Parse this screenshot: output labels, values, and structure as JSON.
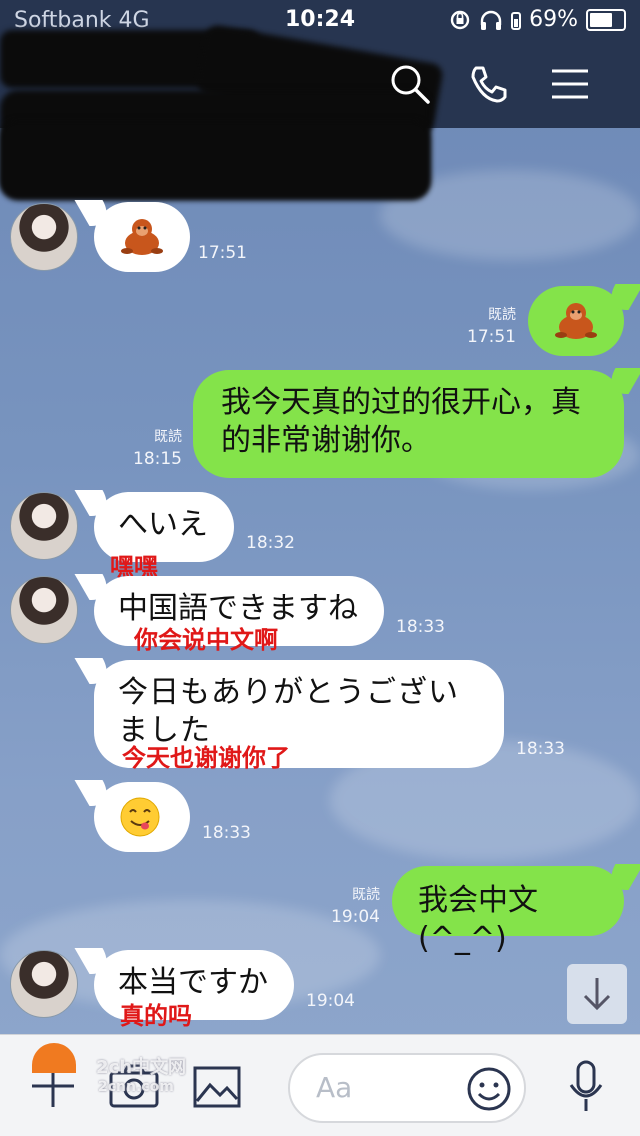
{
  "status": {
    "carrier": "Softbank  4G",
    "time": "10:24",
    "battery": "69%",
    "battery_level": 0.69
  },
  "header": {
    "search_icon": "search-icon",
    "call_icon": "phone-icon",
    "menu_icon": "menu-icon"
  },
  "messages": [
    {
      "side": "left",
      "content": "sticker:orangutan",
      "time": "17:51"
    },
    {
      "side": "right",
      "content": "sticker:orangutan",
      "read": "既読",
      "time": "17:51"
    },
    {
      "side": "right",
      "text": "我今天真的过的很开心，真的非常谢谢你。",
      "read": "既読",
      "time": "18:15"
    },
    {
      "side": "left",
      "text": "へいえ",
      "annotation": "嘿嘿",
      "time": "18:32"
    },
    {
      "side": "left",
      "text": "中国語できますね",
      "annotation": "你会说中文啊",
      "time": "18:33"
    },
    {
      "side": "left",
      "text": "今日もありがとうございました",
      "annotation": "今天也谢谢你了",
      "time": "18:33"
    },
    {
      "side": "left",
      "content": "emoji:yum",
      "time": "18:33"
    },
    {
      "side": "right",
      "text": "我会中文(^_^)",
      "read": "既読",
      "time": "19:04"
    },
    {
      "side": "left",
      "text": "本当ですか",
      "annotation": "真的吗",
      "time": "19:04"
    }
  ],
  "input": {
    "placeholder": "Aa"
  },
  "watermark": {
    "line1": "2ch中文网",
    "line2": "2cnn.com"
  },
  "colors": {
    "header": "#273550",
    "sent": "#84e34a",
    "received": "#ffffff",
    "annotation": "#e01818"
  }
}
